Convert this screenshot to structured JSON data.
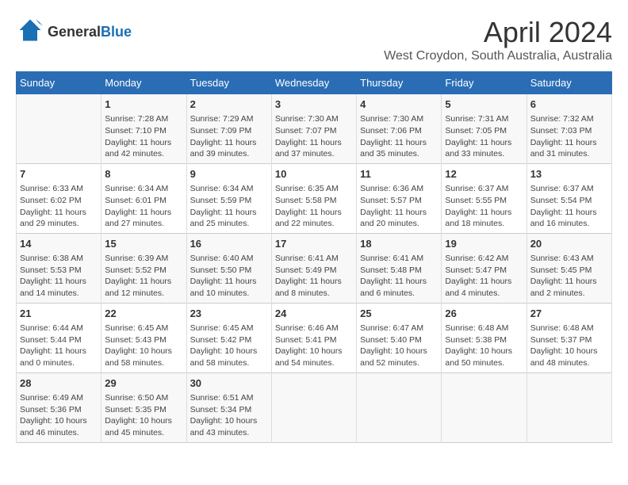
{
  "header": {
    "logo_general": "General",
    "logo_blue": "Blue",
    "title": "April 2024",
    "subtitle": "West Croydon, South Australia, Australia"
  },
  "days_of_week": [
    "Sunday",
    "Monday",
    "Tuesday",
    "Wednesday",
    "Thursday",
    "Friday",
    "Saturday"
  ],
  "weeks": [
    [
      {
        "day": "",
        "info": ""
      },
      {
        "day": "1",
        "info": "Sunrise: 7:28 AM\nSunset: 7:10 PM\nDaylight: 11 hours\nand 42 minutes."
      },
      {
        "day": "2",
        "info": "Sunrise: 7:29 AM\nSunset: 7:09 PM\nDaylight: 11 hours\nand 39 minutes."
      },
      {
        "day": "3",
        "info": "Sunrise: 7:30 AM\nSunset: 7:07 PM\nDaylight: 11 hours\nand 37 minutes."
      },
      {
        "day": "4",
        "info": "Sunrise: 7:30 AM\nSunset: 7:06 PM\nDaylight: 11 hours\nand 35 minutes."
      },
      {
        "day": "5",
        "info": "Sunrise: 7:31 AM\nSunset: 7:05 PM\nDaylight: 11 hours\nand 33 minutes."
      },
      {
        "day": "6",
        "info": "Sunrise: 7:32 AM\nSunset: 7:03 PM\nDaylight: 11 hours\nand 31 minutes."
      }
    ],
    [
      {
        "day": "7",
        "info": "Sunrise: 6:33 AM\nSunset: 6:02 PM\nDaylight: 11 hours\nand 29 minutes."
      },
      {
        "day": "8",
        "info": "Sunrise: 6:34 AM\nSunset: 6:01 PM\nDaylight: 11 hours\nand 27 minutes."
      },
      {
        "day": "9",
        "info": "Sunrise: 6:34 AM\nSunset: 5:59 PM\nDaylight: 11 hours\nand 25 minutes."
      },
      {
        "day": "10",
        "info": "Sunrise: 6:35 AM\nSunset: 5:58 PM\nDaylight: 11 hours\nand 22 minutes."
      },
      {
        "day": "11",
        "info": "Sunrise: 6:36 AM\nSunset: 5:57 PM\nDaylight: 11 hours\nand 20 minutes."
      },
      {
        "day": "12",
        "info": "Sunrise: 6:37 AM\nSunset: 5:55 PM\nDaylight: 11 hours\nand 18 minutes."
      },
      {
        "day": "13",
        "info": "Sunrise: 6:37 AM\nSunset: 5:54 PM\nDaylight: 11 hours\nand 16 minutes."
      }
    ],
    [
      {
        "day": "14",
        "info": "Sunrise: 6:38 AM\nSunset: 5:53 PM\nDaylight: 11 hours\nand 14 minutes."
      },
      {
        "day": "15",
        "info": "Sunrise: 6:39 AM\nSunset: 5:52 PM\nDaylight: 11 hours\nand 12 minutes."
      },
      {
        "day": "16",
        "info": "Sunrise: 6:40 AM\nSunset: 5:50 PM\nDaylight: 11 hours\nand 10 minutes."
      },
      {
        "day": "17",
        "info": "Sunrise: 6:41 AM\nSunset: 5:49 PM\nDaylight: 11 hours\nand 8 minutes."
      },
      {
        "day": "18",
        "info": "Sunrise: 6:41 AM\nSunset: 5:48 PM\nDaylight: 11 hours\nand 6 minutes."
      },
      {
        "day": "19",
        "info": "Sunrise: 6:42 AM\nSunset: 5:47 PM\nDaylight: 11 hours\nand 4 minutes."
      },
      {
        "day": "20",
        "info": "Sunrise: 6:43 AM\nSunset: 5:45 PM\nDaylight: 11 hours\nand 2 minutes."
      }
    ],
    [
      {
        "day": "21",
        "info": "Sunrise: 6:44 AM\nSunset: 5:44 PM\nDaylight: 11 hours\nand 0 minutes."
      },
      {
        "day": "22",
        "info": "Sunrise: 6:45 AM\nSunset: 5:43 PM\nDaylight: 10 hours\nand 58 minutes."
      },
      {
        "day": "23",
        "info": "Sunrise: 6:45 AM\nSunset: 5:42 PM\nDaylight: 10 hours\nand 58 minutes."
      },
      {
        "day": "24",
        "info": "Sunrise: 6:46 AM\nSunset: 5:41 PM\nDaylight: 10 hours\nand 54 minutes."
      },
      {
        "day": "25",
        "info": "Sunrise: 6:47 AM\nSunset: 5:40 PM\nDaylight: 10 hours\nand 52 minutes."
      },
      {
        "day": "26",
        "info": "Sunrise: 6:48 AM\nSunset: 5:38 PM\nDaylight: 10 hours\nand 50 minutes."
      },
      {
        "day": "27",
        "info": "Sunrise: 6:48 AM\nSunset: 5:37 PM\nDaylight: 10 hours\nand 48 minutes."
      }
    ],
    [
      {
        "day": "28",
        "info": "Sunrise: 6:49 AM\nSunset: 5:36 PM\nDaylight: 10 hours\nand 46 minutes."
      },
      {
        "day": "29",
        "info": "Sunrise: 6:50 AM\nSunset: 5:35 PM\nDaylight: 10 hours\nand 45 minutes."
      },
      {
        "day": "30",
        "info": "Sunrise: 6:51 AM\nSunset: 5:34 PM\nDaylight: 10 hours\nand 43 minutes."
      },
      {
        "day": "",
        "info": ""
      },
      {
        "day": "",
        "info": ""
      },
      {
        "day": "",
        "info": ""
      },
      {
        "day": "",
        "info": ""
      }
    ]
  ]
}
